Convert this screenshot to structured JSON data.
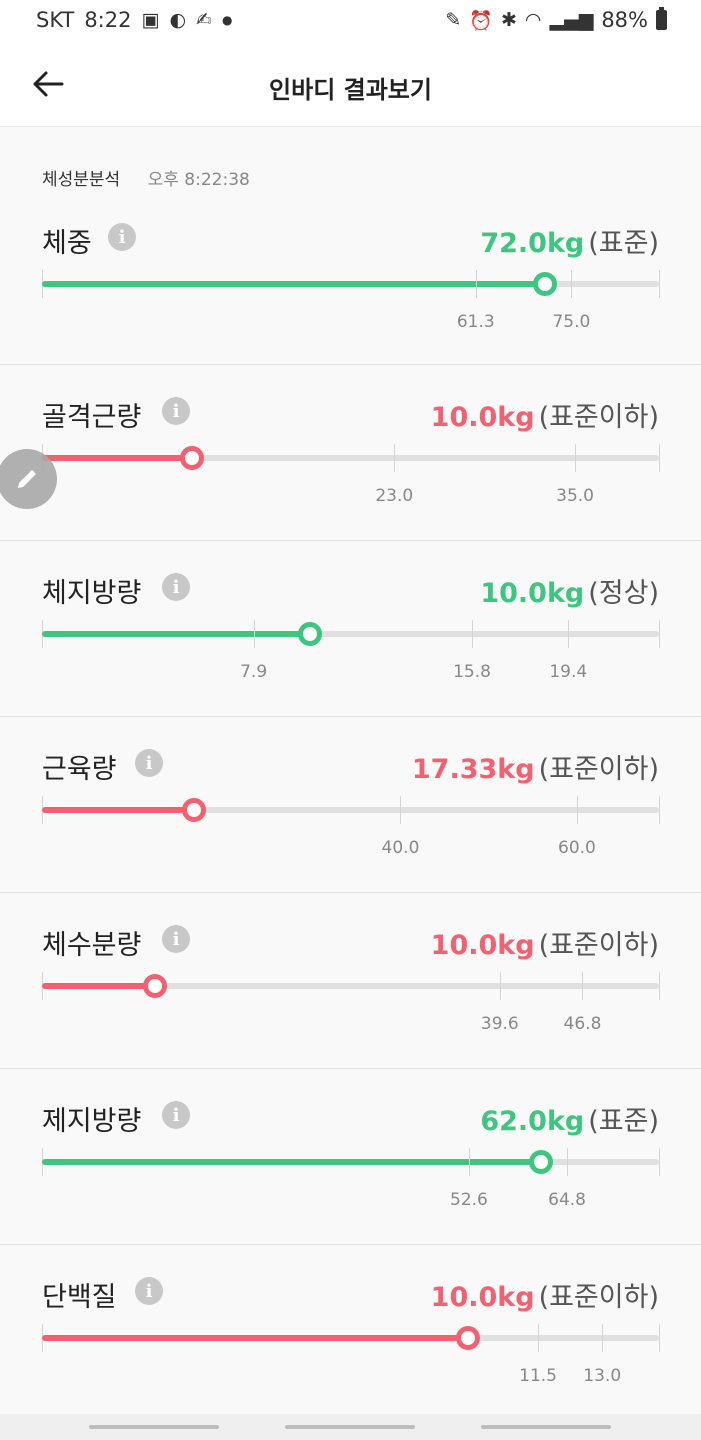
{
  "status_bar": {
    "carrier": "SKT",
    "time": "8:22",
    "battery": "88%",
    "left_icons": [
      "gallery-icon",
      "app-icon",
      "fitness-icon",
      "dot-icon"
    ],
    "right_icons": [
      "edit-icon",
      "alarm-icon",
      "bluetooth-icon",
      "wifi-icon",
      "signal-icon",
      "battery-icon"
    ]
  },
  "header": {
    "title": "인바디 결과보기"
  },
  "section": {
    "title": "체성분분석",
    "time": "오후 8:22:38"
  },
  "colors": {
    "good": "#3ec57f",
    "bad": "#f26172"
  },
  "metrics": [
    {
      "name": "체중",
      "value": "72.0kg",
      "status": "(표준)",
      "level": "good",
      "position": 0.815,
      "ticks": [
        {
          "label": "61.3",
          "pos": 0.703
        },
        {
          "label": "75.0",
          "pos": 0.858
        }
      ]
    },
    {
      "name": "골격근량",
      "value": "10.0kg",
      "status": "(표준이하)",
      "level": "bad",
      "position": 0.243,
      "ticks": [
        {
          "label": "23.0",
          "pos": 0.571
        },
        {
          "label": "35.0",
          "pos": 0.864
        }
      ]
    },
    {
      "name": "체지방량",
      "value": "10.0kg",
      "status": "(정상)",
      "level": "good",
      "position": 0.434,
      "ticks": [
        {
          "label": "7.9",
          "pos": 0.343
        },
        {
          "label": "15.8",
          "pos": 0.697
        },
        {
          "label": "19.4",
          "pos": 0.853
        }
      ]
    },
    {
      "name": "근육량",
      "value": "17.33kg",
      "status": "(표준이하)",
      "level": "bad",
      "position": 0.246,
      "ticks": [
        {
          "label": "40.0",
          "pos": 0.581
        },
        {
          "label": "60.0",
          "pos": 0.867
        }
      ]
    },
    {
      "name": "체수분량",
      "value": "10.0kg",
      "status": "(표준이하)",
      "level": "bad",
      "position": 0.183,
      "ticks": [
        {
          "label": "39.6",
          "pos": 0.742
        },
        {
          "label": "46.8",
          "pos": 0.876
        }
      ]
    },
    {
      "name": "제지방량",
      "value": "62.0kg",
      "status": "(표준)",
      "level": "good",
      "position": 0.808,
      "ticks": [
        {
          "label": "52.6",
          "pos": 0.692
        },
        {
          "label": "64.8",
          "pos": 0.851
        }
      ]
    },
    {
      "name": "단백질",
      "value": "10.0kg",
      "status": "(표준이하)",
      "level": "bad",
      "position": 0.69,
      "ticks": [
        {
          "label": "11.5",
          "pos": 0.804
        },
        {
          "label": "13.0",
          "pos": 0.908
        }
      ]
    }
  ]
}
